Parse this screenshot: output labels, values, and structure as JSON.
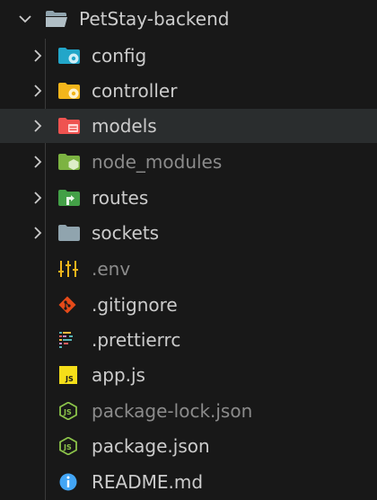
{
  "explorer": {
    "root": {
      "label": "PetStay-backend",
      "icon": "folder-open-icon",
      "expanded": true
    },
    "items": [
      {
        "label": "config",
        "type": "folder",
        "icon": "folder-config-icon",
        "color": "#22a6c9",
        "dim": false
      },
      {
        "label": "controller",
        "type": "folder",
        "icon": "folder-controller-icon",
        "color": "#f3b51b",
        "dim": false
      },
      {
        "label": "models",
        "type": "folder",
        "icon": "folder-models-icon",
        "color": "#ef5350",
        "dim": false
      },
      {
        "label": "node_modules",
        "type": "folder",
        "icon": "folder-node-icon",
        "color": "#8bc34a",
        "dim": true
      },
      {
        "label": "routes",
        "type": "folder",
        "icon": "folder-routes-icon",
        "color": "#43a047",
        "dim": false
      },
      {
        "label": "sockets",
        "type": "folder",
        "icon": "folder-icon",
        "color": "#90a4ae",
        "dim": false
      },
      {
        "label": ".env",
        "type": "file",
        "icon": "env-sliders-icon",
        "color": "#f3b51b",
        "dim": true
      },
      {
        "label": ".gitignore",
        "type": "file",
        "icon": "git-icon",
        "color": "#e64a19",
        "dim": false
      },
      {
        "label": ".prettierrc",
        "type": "file",
        "icon": "prettier-icon",
        "color": "#56b3b4",
        "dim": false
      },
      {
        "label": "app.js",
        "type": "file",
        "icon": "javascript-icon",
        "color": "#f5de19",
        "dim": false
      },
      {
        "label": "package-lock.json",
        "type": "file",
        "icon": "nodejs-icon",
        "color": "#8bc34a",
        "dim": true
      },
      {
        "label": "package.json",
        "type": "file",
        "icon": "nodejs-icon",
        "color": "#8bc34a",
        "dim": false
      },
      {
        "label": "README.md",
        "type": "file",
        "icon": "info-icon",
        "color": "#42a5f5",
        "dim": false
      }
    ],
    "selected": "models",
    "colors": {
      "background": "#181818",
      "selection": "#2a2d2e",
      "text": "#cccccc",
      "dim_text": "#8b8b8b"
    }
  }
}
